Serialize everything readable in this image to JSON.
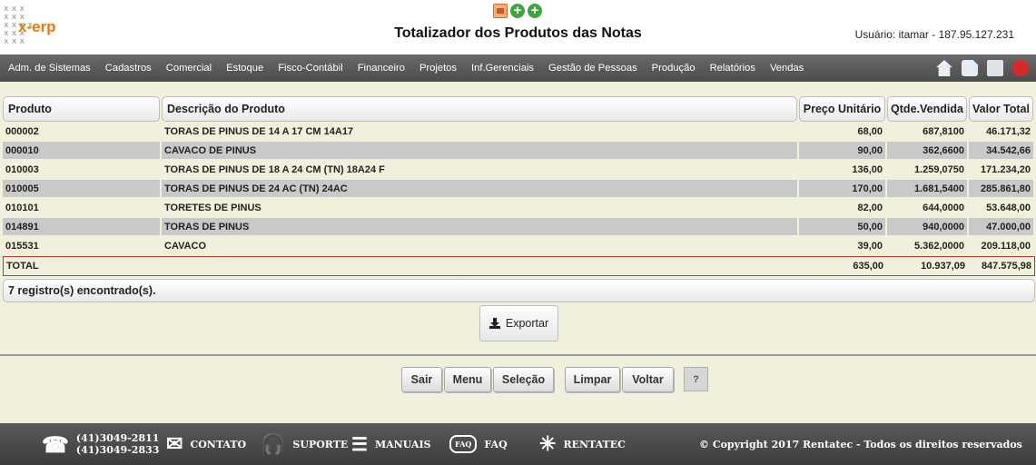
{
  "brand": {
    "logo_text": "x-erp"
  },
  "header": {
    "title": "Totalizador dos Produtos das Notas",
    "user_info": "Usuário: itamar - 187.95.127.231"
  },
  "menu": {
    "items": [
      "Adm. de Sistemas",
      "Cadastros",
      "Comercial",
      "Estoque",
      "Fisco-Contábil",
      "Financeiro",
      "Projetos",
      "Inf.Gerenciais",
      "Gestão de Pessoas",
      "Produção",
      "Relatórios",
      "Vendas"
    ],
    "right_icons": [
      "home-icon",
      "document-icon",
      "printer-icon",
      "power-icon"
    ]
  },
  "table": {
    "columns": [
      "Produto",
      "Descrição do Produto",
      "Preço Unitário",
      "Qtde.Vendida",
      "Valor Total"
    ],
    "rows": [
      {
        "produto": "000002",
        "descricao": "TORAS DE PINUS DE 14 A 17 CM 14A17",
        "preco": "68,00",
        "qtde": "687,8100",
        "valor": "46.171,32"
      },
      {
        "produto": "000010",
        "descricao": "CAVACO DE PINUS",
        "preco": "90,00",
        "qtde": "362,6600",
        "valor": "34.542,66"
      },
      {
        "produto": "010003",
        "descricao": "TORAS DE PINUS DE 18 A 24 CM (TN) 18A24 F",
        "preco": "136,00",
        "qtde": "1.259,0750",
        "valor": "171.234,20"
      },
      {
        "produto": "010005",
        "descricao": "TORAS DE PINUS DE 24 AC (TN) 24AC",
        "preco": "170,00",
        "qtde": "1.681,5400",
        "valor": "285.861,80"
      },
      {
        "produto": "010101",
        "descricao": "TORETES DE PINUS",
        "preco": "82,00",
        "qtde": "644,0000",
        "valor": "53.648,00"
      },
      {
        "produto": "014891",
        "descricao": "TORAS DE PINUS",
        "preco": "50,00",
        "qtde": "940,0000",
        "valor": "47.000,00"
      },
      {
        "produto": "015531",
        "descricao": "CAVACO",
        "preco": "39,00",
        "qtde": "5.362,0000",
        "valor": "209.118,00"
      }
    ],
    "total": {
      "label": "TOTAL",
      "preco": "635,00",
      "qtde": "10.937,09",
      "valor": "847.575,98"
    },
    "records_text": "7 registro(s) encontrado(s)."
  },
  "actions": {
    "export_label": "Exportar",
    "sair": "Sair",
    "menu": "Menu",
    "selecao": "Seleção",
    "limpar": "Limpar",
    "voltar": "Voltar",
    "help": "?"
  },
  "footer": {
    "phone1": "(41)3049-2811",
    "phone2": "(41)3049-2833",
    "contato": "CONTATO",
    "suporte": "SUPORTE",
    "manuais": "MANUAIS",
    "faq": "FAQ",
    "faq_icon_text": "FAQ",
    "rentatec": "RENTATEC",
    "copyright": "© Copyright 2017 Rentatec - Todos os direitos reservados"
  },
  "colors": {
    "accent": "#e07b16",
    "menubar": "#555555",
    "content_bg": "#f1f0dd",
    "total_border": "#c0392b"
  }
}
